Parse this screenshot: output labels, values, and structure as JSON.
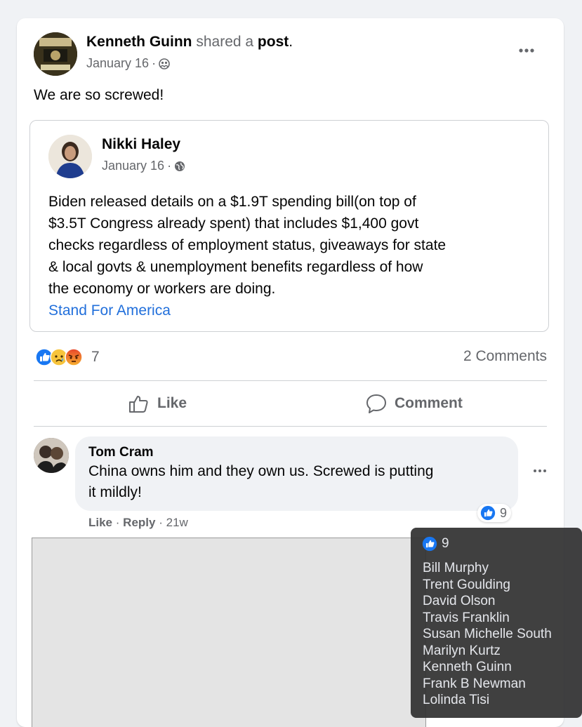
{
  "post": {
    "author": "Kenneth Guinn",
    "action_text": "shared a",
    "action_link": "post",
    "action_end": ".",
    "date": "January 16",
    "separator": "·",
    "text": "We are so screwed!"
  },
  "shared": {
    "author": "Nikki Haley",
    "date": "January 16",
    "separator": "·",
    "lines": [
      "Biden released details on a $1.9T spending bill(on top of",
      "$3.5T Congress already spent) that includes $1,400 govt",
      "checks regardless of employment status, giveaways for state",
      "& local govts & unemployment benefits regardless of how",
      "the economy or workers are doing."
    ],
    "link": "Stand For America"
  },
  "reactions": {
    "count": "7",
    "comments": "2 Comments"
  },
  "actions": {
    "like": "Like",
    "comment": "Comment"
  },
  "comment": {
    "author": "Tom Cram",
    "line1": "China owns him and they own us. Screwed is putting",
    "line2": "it mildly!",
    "reaction_count": "9",
    "like": "Like",
    "reply": "Reply",
    "sep": "·",
    "age": "21w",
    "more": "..."
  },
  "tooltip": {
    "count": "9",
    "names": [
      "Bill Murphy",
      "Trent Goulding",
      "David Olson",
      "Travis Franklin",
      "Susan Michelle South",
      "Marilyn Kurtz",
      "Kenneth Guinn",
      "Frank B Newman",
      "Lolinda Tisi"
    ]
  },
  "colors": {
    "like_blue": "#1877f2",
    "link_blue": "#216fdb",
    "muted": "#65676b"
  },
  "icons": [
    "more-options-icon",
    "friends-privacy-icon",
    "globe-icon",
    "like-reaction-icon",
    "sad-reaction-icon",
    "angry-reaction-icon",
    "thumbs-up-icon",
    "comment-icon"
  ]
}
